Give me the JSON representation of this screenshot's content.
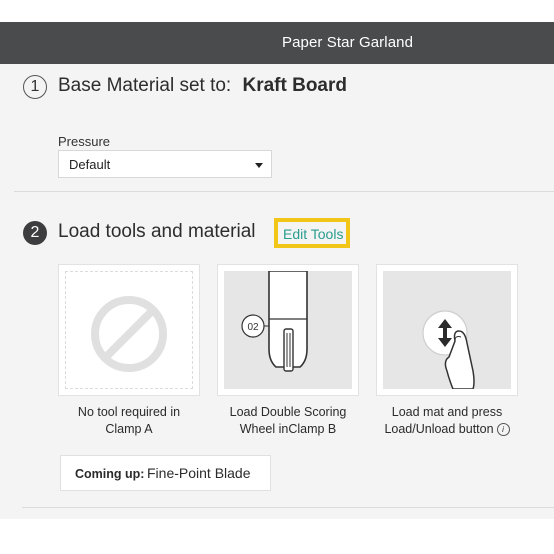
{
  "header": {
    "title": "Paper Star Garland"
  },
  "step1": {
    "number": "1",
    "title_prefix": "Base Material set to:",
    "material": "Kraft Board",
    "pressure_label": "Pressure",
    "pressure_value": "Default"
  },
  "step2": {
    "number": "2",
    "title": "Load tools and material",
    "edit_tools_label": "Edit Tools"
  },
  "cards": [
    {
      "caption_line1": "No tool required in",
      "caption_line2": "Clamp A",
      "icon": "no-tool-icon"
    },
    {
      "caption_line1": "Load Double Scoring",
      "caption_line2": "Wheel inClamp B",
      "icon": "scoring-wheel-icon",
      "tool_tag": "02"
    },
    {
      "caption_line1": "Load mat and press",
      "caption_line2": "Load/Unload button",
      "icon": "load-unload-icon"
    }
  ],
  "coming_up": {
    "label": "Coming up:",
    "value": "Fine-Point Blade"
  },
  "colors": {
    "header_bg": "#4a4b4d",
    "accent_teal": "#2a9d8f",
    "highlight_yellow": "#f2c618",
    "panel_bg": "#f4f4f4"
  }
}
